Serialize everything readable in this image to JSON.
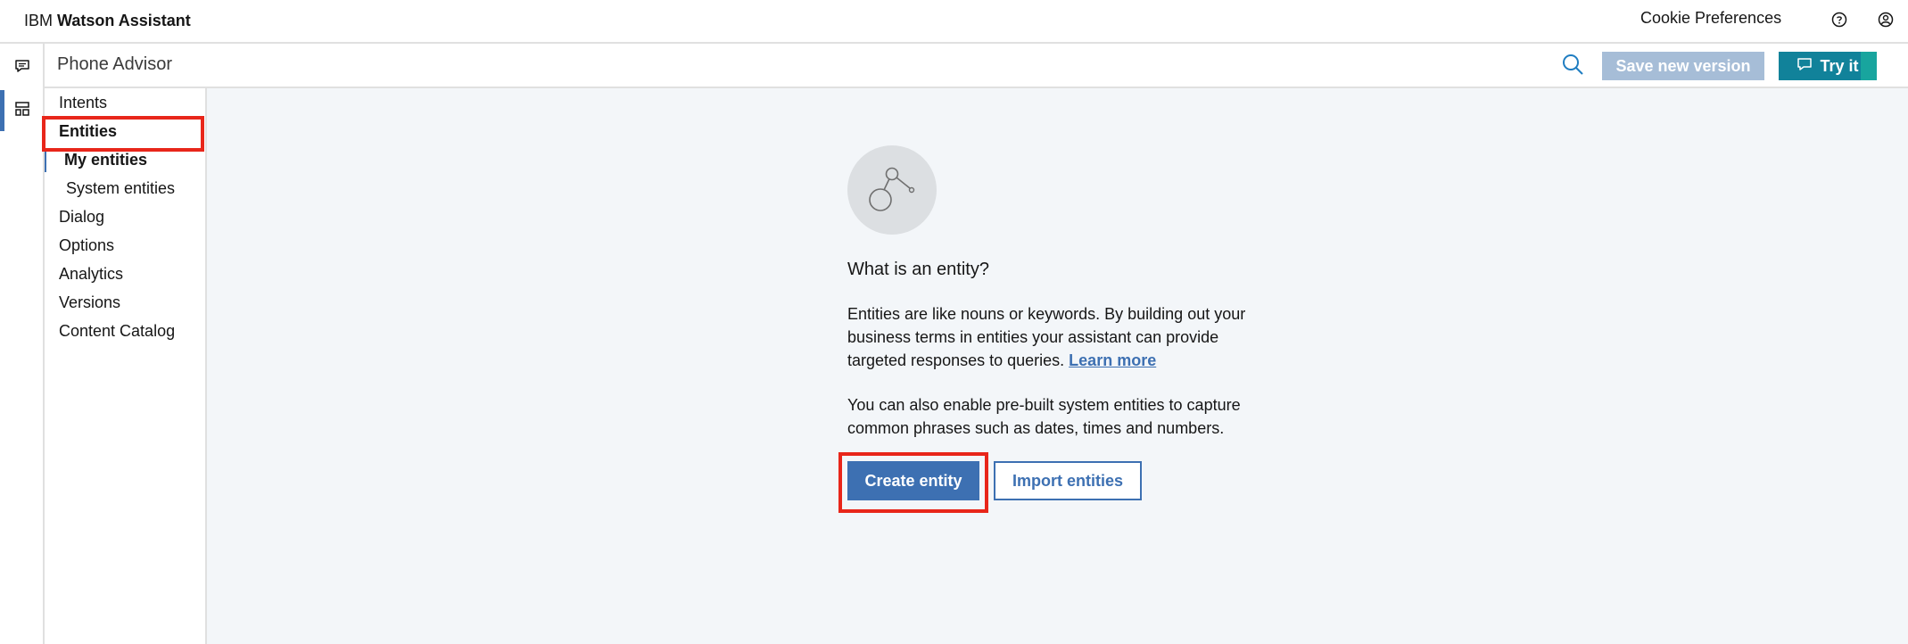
{
  "header": {
    "brand_prefix": "IBM",
    "brand_name": "Watson Assistant",
    "cookie_link": "Cookie Preferences",
    "help_icon": "help-icon",
    "user_icon": "user-avatar-icon"
  },
  "rail": {
    "items": [
      {
        "icon": "chat-icon"
      },
      {
        "icon": "skills-icon"
      }
    ]
  },
  "subheader": {
    "skill_title": "Phone Advisor",
    "save_label": "Save new version",
    "try_label": "Try it"
  },
  "sidebar": {
    "items": [
      {
        "label": "Intents"
      },
      {
        "label": "Entities"
      },
      {
        "label": "My entities"
      },
      {
        "label": "System entities"
      },
      {
        "label": "Dialog"
      },
      {
        "label": "Options"
      },
      {
        "label": "Analytics"
      },
      {
        "label": "Versions"
      },
      {
        "label": "Content Catalog"
      }
    ]
  },
  "main": {
    "title": "What is an entity?",
    "para1": "Entities are like nouns or keywords. By building out your business terms in entities your assistant can provide targeted responses to queries.",
    "learn_more": "Learn more",
    "para2": "You can also enable pre-built system entities to capture common phrases such as dates, times and numbers.",
    "create_label": "Create entity",
    "import_label": "Import entities"
  },
  "colors": {
    "primary": "#3d70b2",
    "try_button": "#11829a",
    "highlight": "#e8261a"
  }
}
